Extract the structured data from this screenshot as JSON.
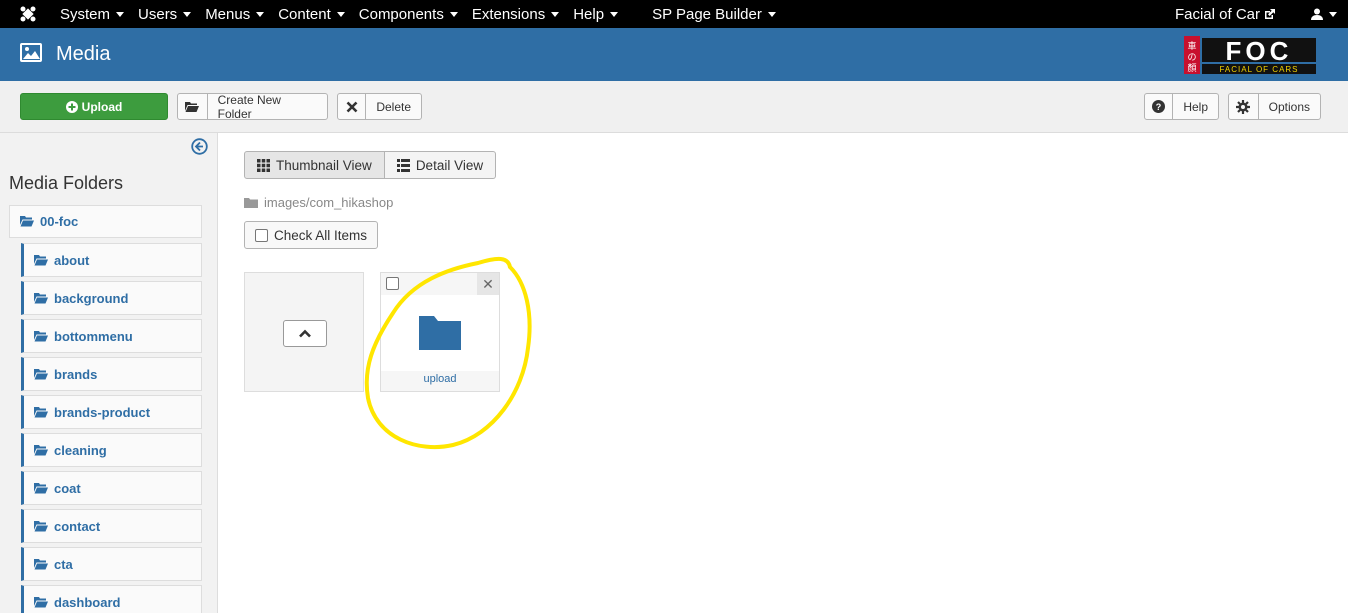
{
  "topnav": {
    "menus": [
      {
        "label": "System"
      },
      {
        "label": "Users"
      },
      {
        "label": "Menus"
      },
      {
        "label": "Content"
      },
      {
        "label": "Components"
      },
      {
        "label": "Extensions"
      },
      {
        "label": "Help"
      },
      {
        "label": "SP Page Builder"
      }
    ],
    "site_link": "Facial of Car"
  },
  "header": {
    "title": "Media",
    "logo_text": "FOC",
    "logo_subtext": "FACIAL OF CARS"
  },
  "toolbar": {
    "upload": "Upload",
    "create_folder": "Create New Folder",
    "delete": "Delete",
    "help": "Help",
    "options": "Options"
  },
  "sidebar": {
    "heading": "Media Folders",
    "root": "00-foc",
    "folders": [
      "about",
      "background",
      "bottommenu",
      "brands",
      "brands-product",
      "cleaning",
      "coat",
      "contact",
      "cta",
      "dashboard"
    ]
  },
  "main": {
    "thumbnail_view": "Thumbnail View",
    "detail_view": "Detail View",
    "path": "images/com_hikashop",
    "check_all": "Check All Items",
    "items": [
      {
        "name": "upload"
      }
    ]
  },
  "colors": {
    "nav_bg": "#000000",
    "header_bg": "#2f6ea5",
    "upload_green": "#3d9c3e",
    "folder_blue": "#2f6ea5",
    "highlight": "#ffe600"
  }
}
